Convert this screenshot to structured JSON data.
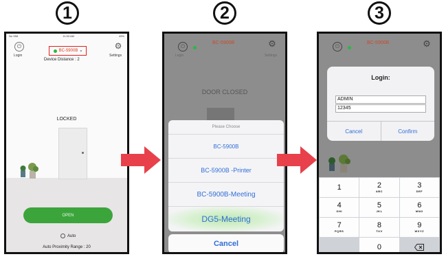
{
  "steps": [
    "1",
    "2",
    "3"
  ],
  "phone1": {
    "status_left": "No SIM",
    "status_time": "11:53 AM",
    "status_right": "49%",
    "login_label": "Login",
    "device_name": "BC-5900B",
    "settings_label": "Settings",
    "device_distance": "Device Distance : 2",
    "lock_status": "LOCKED",
    "open_button": "OPEN",
    "auto_label": "Auto",
    "auto_proximity": "Auto Proximity Range : 20"
  },
  "phone2": {
    "header_device": "BC-5900B",
    "login_label": "Login",
    "settings_label": "Settings",
    "door_status": "DOOR CLOSED",
    "sheet_title": "Please Choose",
    "options": [
      "BC-5900B",
      "BC-5900B -Printer",
      "BC-5900B-Meeting",
      "DG5-Meeting"
    ],
    "cancel": "Cancel"
  },
  "phone3": {
    "header_device": "BC-5900B",
    "dialog_title": "Login:",
    "username_value": "ADMIN",
    "password_value": "12345",
    "cancel": "Cancel",
    "confirm": "Confirm",
    "keys": [
      {
        "digit": "1",
        "letters": ""
      },
      {
        "digit": "2",
        "letters": "ABC"
      },
      {
        "digit": "3",
        "letters": "DEF"
      },
      {
        "digit": "4",
        "letters": "GHI"
      },
      {
        "digit": "5",
        "letters": "JKL"
      },
      {
        "digit": "6",
        "letters": "MNO"
      },
      {
        "digit": "7",
        "letters": "PQRS"
      },
      {
        "digit": "8",
        "letters": "TUV"
      },
      {
        "digit": "9",
        "letters": "WXYZ"
      },
      {
        "digit": "0",
        "letters": ""
      }
    ]
  },
  "colors": {
    "arrow": "#e8414b",
    "open_button": "#3ba53b",
    "device_highlight": "#e0201a",
    "ios_blue": "#2f6dd8"
  }
}
